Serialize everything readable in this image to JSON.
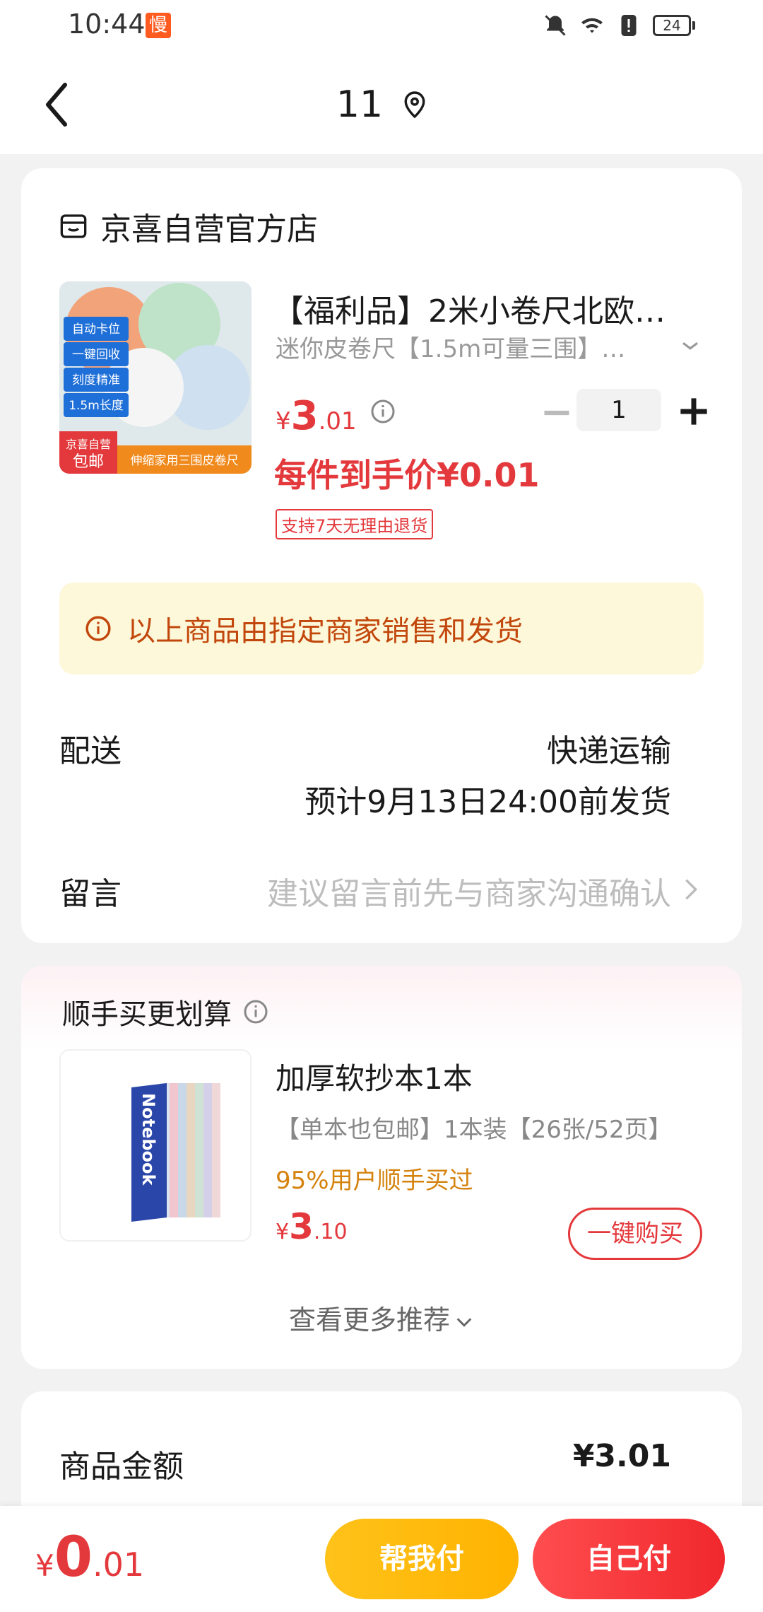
{
  "status_bar": {
    "time": "10:44",
    "slow_badge": "慢",
    "battery": "24"
  },
  "header": {
    "address": "11"
  },
  "order_card": {
    "store_name": "京喜自营官方店",
    "product": {
      "title": "【福利品】2米小卷尺北欧…",
      "spec": "迷你皮卷尺【1.5m可量三围】…",
      "price": {
        "currency": "¥",
        "integer": "3",
        "decimal": ".01"
      },
      "quantity": "1",
      "deal_price": "每件到手价¥0.01",
      "return_policy": "支持7天无理由退货",
      "image_text": {
        "tag1": "自动卡位",
        "tag2": "一键回收",
        "tag3": "刻度精准",
        "tag4": "1.5m长度",
        "badge": "京喜自营",
        "badge2": "包邮",
        "banner": "伸缩家用三围皮卷尺"
      }
    },
    "notice": "以上商品由指定商家销售和发货",
    "delivery": {
      "label": "配送",
      "method": "快递运输",
      "time": "预计9月13日24:00前发货"
    },
    "message": {
      "label": "留言",
      "hint": "建议留言前先与商家沟通确认"
    }
  },
  "recommend_card": {
    "title": "顺手买更划算",
    "item": {
      "name": "加厚软抄本1本",
      "spec": "【单本也包邮】1本装【26张/52页】",
      "social": "95%用户顺手买过",
      "price": {
        "currency": "¥",
        "integer": "3",
        "decimal": ".10"
      },
      "buy_label": "一键购买",
      "image_text": "Notebook"
    },
    "more_label": "查看更多推荐"
  },
  "amount_card": {
    "label": "商品金额",
    "value": "¥3.01"
  },
  "bottom_bar": {
    "total": {
      "currency": "¥",
      "integer": "0",
      "decimal": ".01"
    },
    "help_pay_label": "帮我付",
    "self_pay_label": "自己付"
  },
  "colors": {
    "price_red": "#e4393c",
    "notice_bg": "#fdf8d9",
    "notice_text": "#c2470c",
    "help_btn": "#ffb300",
    "self_btn": "#f0282d"
  }
}
